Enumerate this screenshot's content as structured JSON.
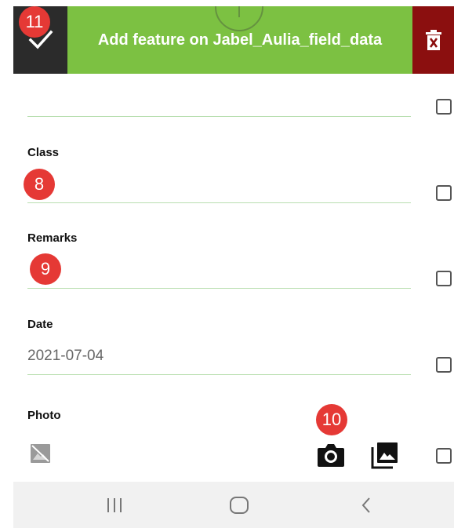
{
  "toolbar": {
    "title": "Add feature on Jabel_Aulia_field_data",
    "confirm_icon": "check-icon",
    "delete_icon": "delete-icon",
    "colors": {
      "confirm_bg": "#2b2b2b",
      "title_bg": "#7cc142",
      "delete_bg": "#8b0f0f"
    }
  },
  "badges": {
    "confirm": "11",
    "class": "8",
    "remarks": "9",
    "camera": "10"
  },
  "form": {
    "fields": [
      {
        "label": "",
        "value": ""
      },
      {
        "label": "Class",
        "value": ""
      },
      {
        "label": "Remarks",
        "value": ""
      },
      {
        "label": "Date",
        "value": "2021-07-04"
      },
      {
        "label": "Photo",
        "value": ""
      }
    ]
  },
  "photo": {
    "placeholder_icon": "broken-image-icon",
    "camera_icon": "camera-icon",
    "gallery_icon": "gallery-icon"
  },
  "navbar": {
    "recents_icon": "recent-apps-icon",
    "home_icon": "home-icon",
    "back_icon": "back-icon"
  }
}
